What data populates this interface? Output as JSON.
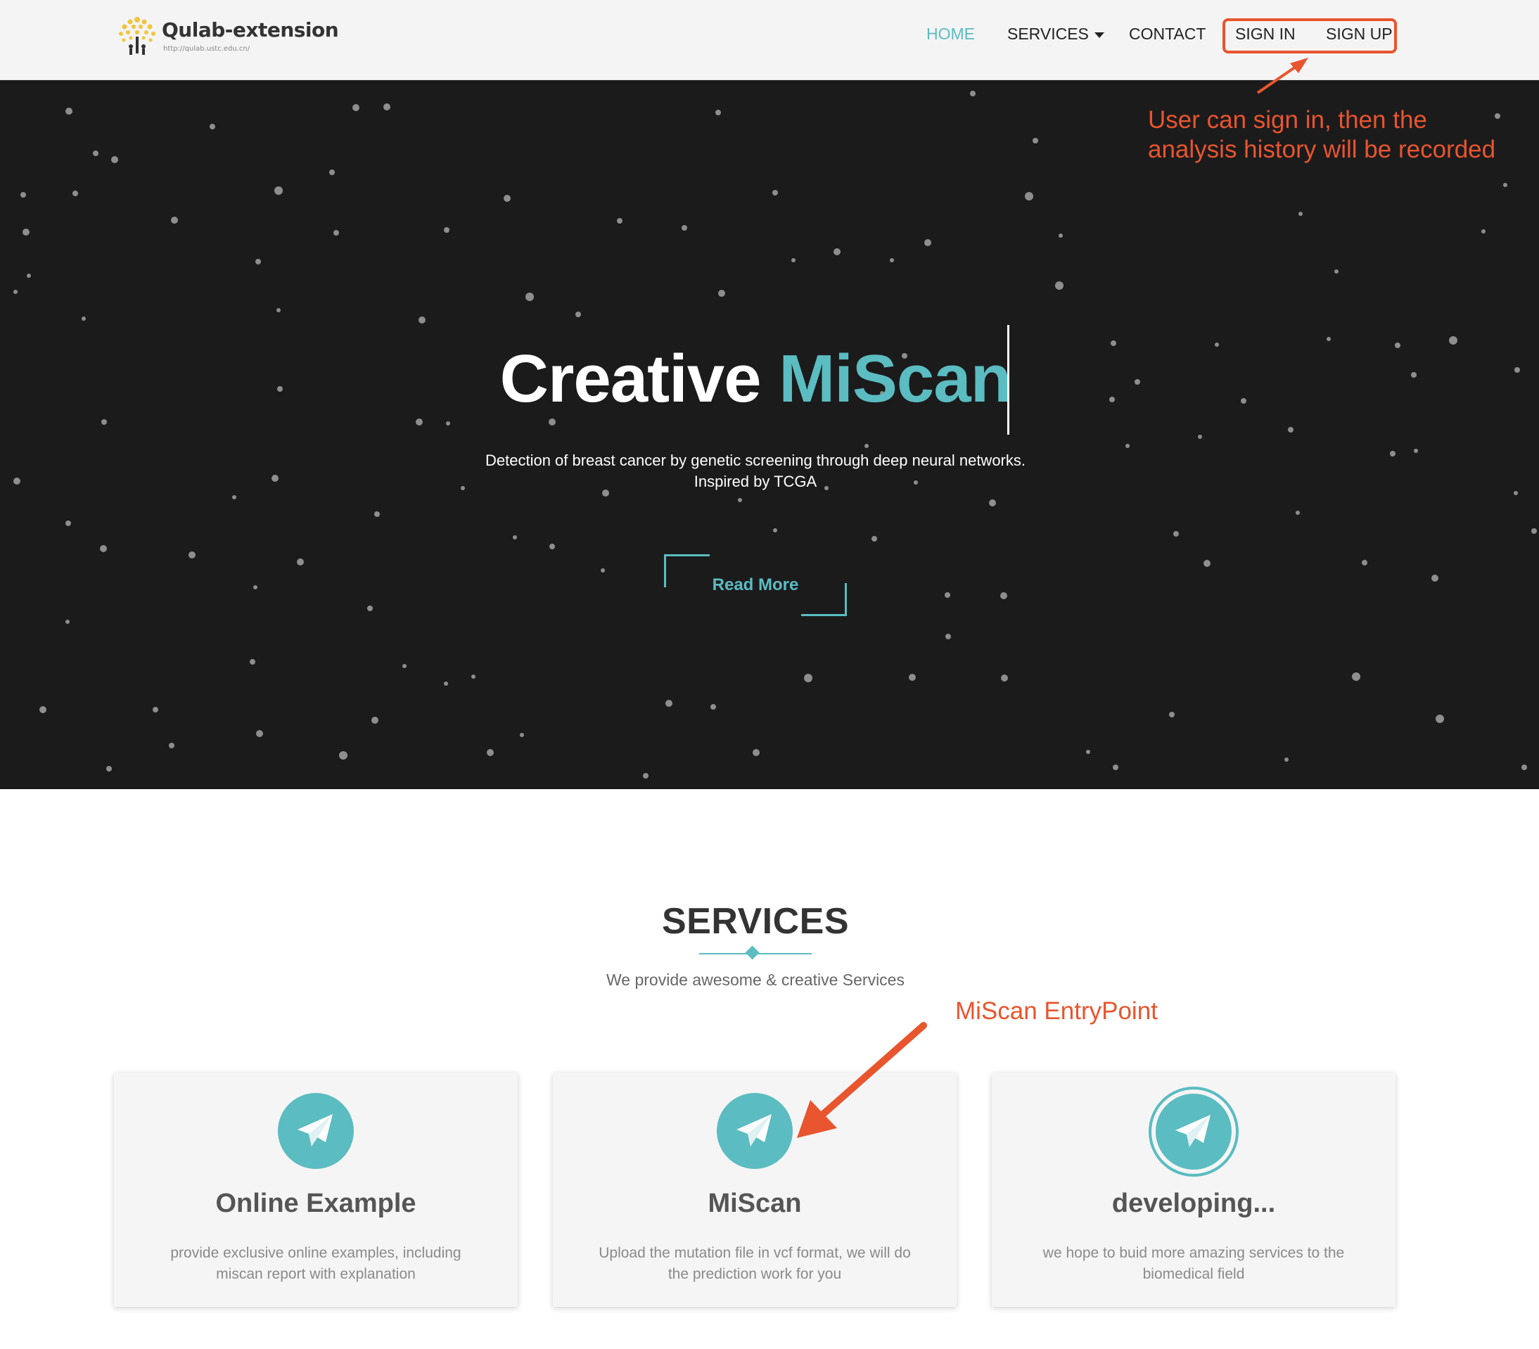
{
  "nav": {
    "logo_text": "Qulab-extension",
    "logo_sub": "http://qulab.ustc.edu.cn/",
    "items": [
      {
        "label": "HOME",
        "active": true
      },
      {
        "label": "SERVICES",
        "has_dropdown": true
      },
      {
        "label": "CONTACT"
      },
      {
        "label": "SIGN IN"
      },
      {
        "label": "SIGN UP"
      }
    ]
  },
  "hero": {
    "title_main": "Creative",
    "title_accent": "MiScan",
    "subtitle_line1": "Detection of breast cancer by genetic screening through deep neural networks.",
    "subtitle_line2": "Inspired by TCGA",
    "read_more": "Read More"
  },
  "annotations": {
    "signin_note_line1": "User can sign in, then the",
    "signin_note_line2": "analysis history will be recorded",
    "entry_note": "MiScan EntryPoint"
  },
  "services": {
    "heading": "SERVICES",
    "subtitle": "We provide awesome & creative Services",
    "cards": [
      {
        "title": "Online Example",
        "desc": "provide exclusive online examples, including miscan report with explanation",
        "icon": "paper-plane-icon"
      },
      {
        "title": "MiScan",
        "desc": "Upload the mutation file in vcf format, we will do the prediction work for you",
        "icon": "paper-plane-icon"
      },
      {
        "title": "developing...",
        "desc": "we hope to buid more amazing services to the biomedical field",
        "icon": "paper-plane-icon"
      }
    ]
  },
  "colors": {
    "accent": "#5bbcc1",
    "annotation": "#e8552e",
    "hero_bg": "#1b1b1c",
    "nav_bg": "#f4f4f4"
  }
}
